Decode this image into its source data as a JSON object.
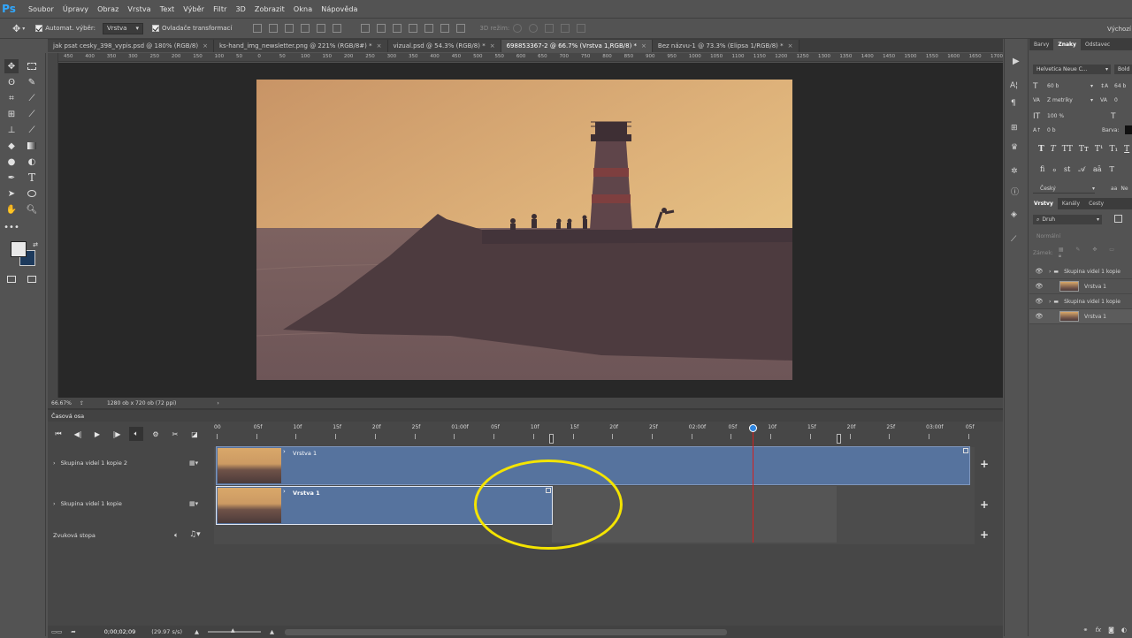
{
  "app": {
    "logo": "Ps"
  },
  "menu": [
    "Soubor",
    "Úpravy",
    "Obraz",
    "Vrstva",
    "Text",
    "Výběr",
    "Filtr",
    "3D",
    "Zobrazit",
    "Okna",
    "Nápověda"
  ],
  "options": {
    "auto_select_label": "Automat. výběr:",
    "auto_select_value": "Vrstva",
    "transform_label": "Ovladače transformací",
    "mode_3d": "3D režim:",
    "workspace": "Výchozí"
  },
  "doc_tabs": [
    {
      "label": "jak psat cesky_398_vypis.psd @ 180% (RGB/8)",
      "active": false
    },
    {
      "label": "ks-hand_img_newsletter.png @ 221% (RGB/8#) *",
      "active": false
    },
    {
      "label": "vizual.psd @ 54.3% (RGB/8) *",
      "active": false
    },
    {
      "label": "698853367-2 @ 66.7% (Vrstva 1,RGB/8) *",
      "active": true
    },
    {
      "label": "Bez názvu-1 @ 73.3% (Elipsa 1/RGB/8) *",
      "active": false
    }
  ],
  "ruler_h": [
    "450",
    "400",
    "350",
    "300",
    "250",
    "200",
    "150",
    "100",
    "50",
    "0",
    "50",
    "100",
    "150",
    "200",
    "250",
    "300",
    "350",
    "400",
    "450",
    "500",
    "550",
    "600",
    "650",
    "700",
    "750",
    "800",
    "850",
    "900",
    "950",
    "1000",
    "1050",
    "1100",
    "1150",
    "1200",
    "1250",
    "1300",
    "1350",
    "1400",
    "1450",
    "1500",
    "1550",
    "1600",
    "1650",
    "1700"
  ],
  "status": {
    "zoom": "66.67%",
    "doc_info": "1280 ob x 720 ob (72 ppi)"
  },
  "timeline": {
    "title": "Časová osa",
    "ruler": [
      "00",
      "05f",
      "10f",
      "15f",
      "20f",
      "25f",
      "01:00f",
      "05f",
      "10f",
      "15f",
      "20f",
      "25f",
      "02:00f",
      "05f",
      "10f",
      "15f",
      "20f",
      "25f",
      "03:00f",
      "05f"
    ],
    "tracks": [
      {
        "label": "Skupina videí 1 kopie 2",
        "clip": "Vrstva 1"
      },
      {
        "label": "Skupina videí 1 kopie",
        "clip": "Vrstva 1"
      }
    ],
    "audio_track": "Zvuková stopa",
    "timecode": "0;00;02;09",
    "fps": "(29.97 s/s)",
    "playhead_fraction": 0.715
  },
  "character_panel": {
    "tabs": [
      "Barvy",
      "Znaky",
      "Odstavec"
    ],
    "font_family": "Helvetica Neue C...",
    "font_style": "Bold",
    "size": "60 b",
    "leading": "64 b",
    "kerning": "Z metriky",
    "tracking": "0",
    "vscale": "100 %",
    "hscale": "100",
    "baseline": "0 b",
    "color_label": "Barva:",
    "language": "Český",
    "aa": "Ne"
  },
  "layers_panel": {
    "tabs": [
      "Vrstvy",
      "Kanály",
      "Cesty"
    ],
    "filter": "Druh",
    "blend": "Normální",
    "lock_label": "Zámek:",
    "rows": [
      {
        "name": "Skupina videí 1 kopie",
        "type": "group"
      },
      {
        "name": "Vrstva 1",
        "type": "layer"
      },
      {
        "name": "Skupina videí 1 kopie",
        "type": "group"
      },
      {
        "name": "Vrstva 1",
        "type": "layer"
      }
    ]
  },
  "colors": {
    "foreground": "#e8e8e8",
    "background": "#1d3a5c",
    "clip": "#56739e",
    "annotation": "#f4e400",
    "playhead": "#d22020"
  }
}
